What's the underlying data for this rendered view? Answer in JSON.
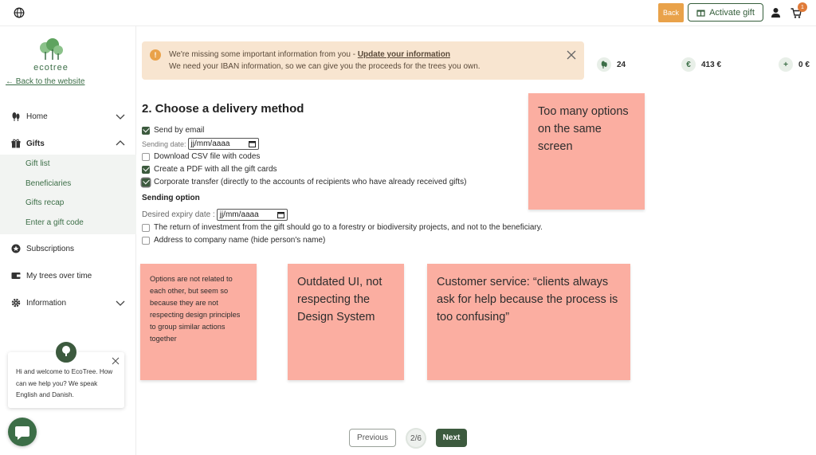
{
  "topbar": {
    "back_label": "Back",
    "activate_label": "Activate gift",
    "cart_count": "1"
  },
  "sidebar": {
    "logo_text": "ecotree",
    "back_link": "← Back to the website",
    "items": [
      {
        "label": "Home",
        "icon": "trees-icon"
      },
      {
        "label": "Gifts",
        "icon": "gift-icon"
      },
      {
        "label": "Subscriptions",
        "icon": "star-icon"
      },
      {
        "label": "My trees over time",
        "icon": "wallet-icon"
      },
      {
        "label": "Information",
        "icon": "gear-icon"
      }
    ],
    "gift_subitems": [
      "Gift list",
      "Beneficiaries",
      "Gifts recap",
      "Enter a gift code"
    ]
  },
  "chat": {
    "avatar_text": "ecotree",
    "message": "Hi and welcome to EcoTree. How can we help you? We speak English and Danish."
  },
  "notice": {
    "line1_prefix": "We're missing some important information from you - ",
    "line1_link": "Update your information",
    "line2": "We need your IBAN information, so we can give you the proceeds for the trees you own."
  },
  "stats": [
    {
      "icon": "tree-icon",
      "value": "24"
    },
    {
      "icon": "euro-icon",
      "value": "413 €"
    },
    {
      "icon": "plus-icon",
      "value": "0 €"
    }
  ],
  "form": {
    "title": "2. Choose a delivery method",
    "send_by_email": "Send by email",
    "sending_date_label": "Sending date:",
    "date_placeholder": "jj/mm/aaaa",
    "download_csv": "Download CSV file with codes",
    "create_pdf": "Create a PDF with all the gift cards",
    "corporate_transfer": "Corporate transfer (directly to the accounts of recipients who have already received gifts)",
    "sending_option_title": "Sending option",
    "expiry_label": "Desired expiry date :",
    "return_investment": "The return of investment from the gift should go to a forestry or biodiversity projects, and not to the beneficiary.",
    "address_company": "Address to company name (hide person's name)",
    "checked": {
      "send_by_email": true,
      "download_csv": false,
      "create_pdf": true,
      "corporate_transfer": true,
      "return_investment": false,
      "address_company": false
    }
  },
  "notes": {
    "note1": "Too many options on the same screen",
    "note2": "Options are not related to each other, but seem so because they are not respecting design principles to group similar actions together",
    "note3": "Outdated UI, not respecting the Design System",
    "note4": "Customer service: “clients always ask for help because the process is too confusing”"
  },
  "pager": {
    "prev_label": "Previous",
    "step": "2/6",
    "next_label": "Next"
  },
  "colors": {
    "brand_green": "#3c6e47",
    "dark_green": "#3c5a3e",
    "accent_orange": "#e9a24a",
    "sticky_pink": "#fbaea1",
    "notice_bg": "#f8e5d0"
  }
}
